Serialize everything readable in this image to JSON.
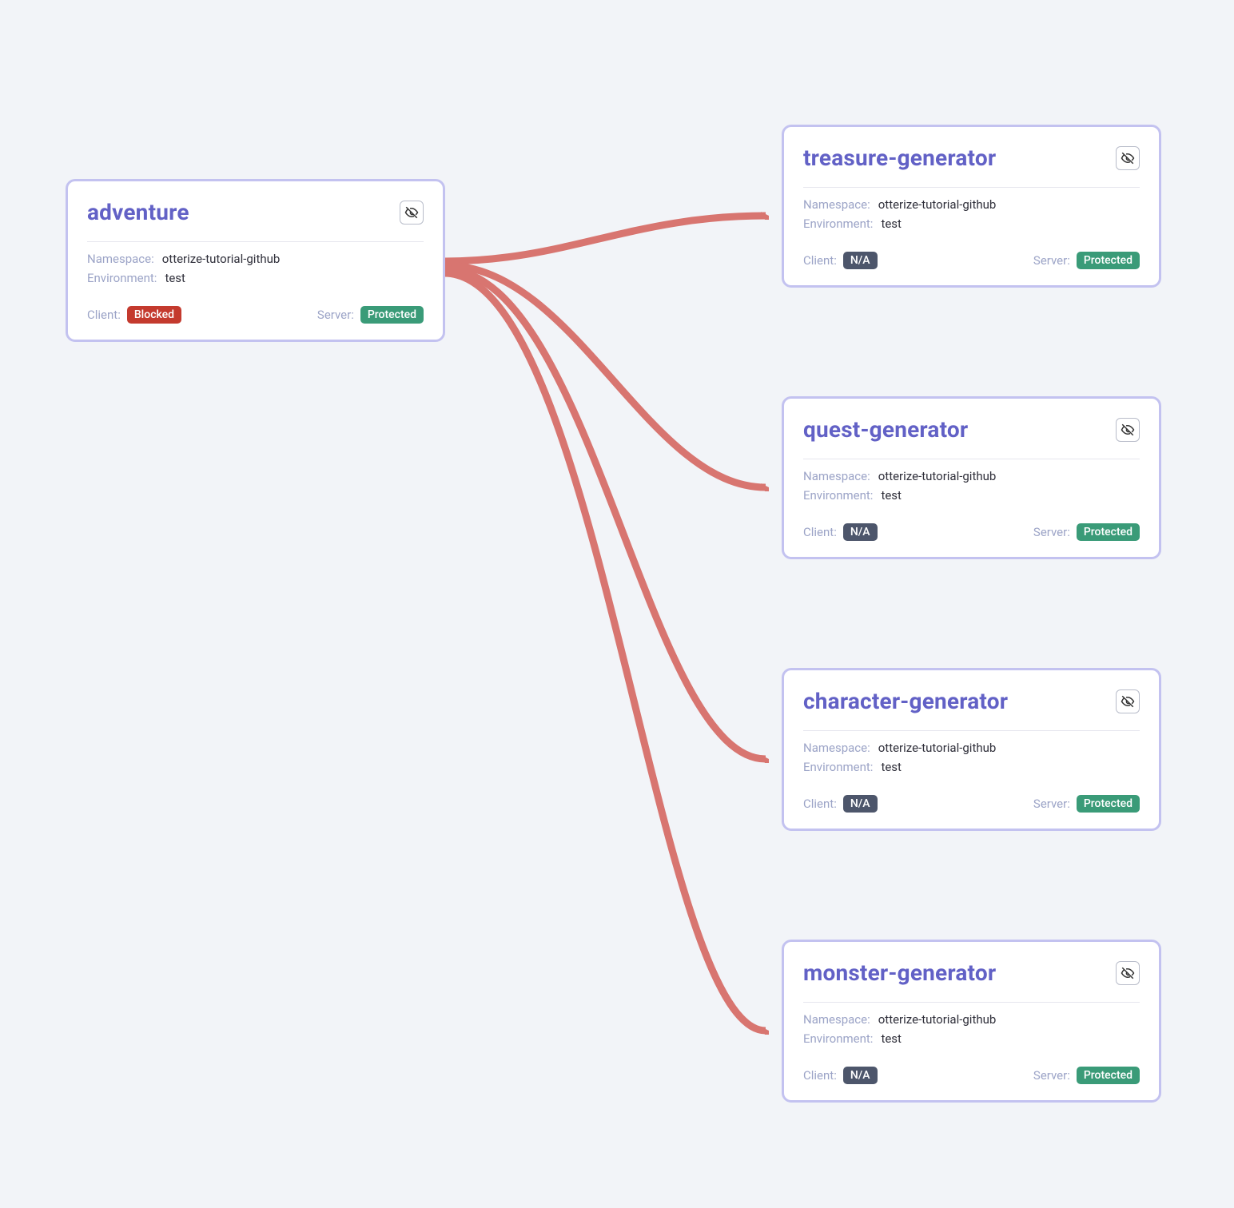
{
  "labels": {
    "namespace": "Namespace:",
    "environment": "Environment:",
    "client": "Client:",
    "server": "Server:"
  },
  "badges": {
    "blocked": "Blocked",
    "na": "N/A",
    "protected": "Protected"
  },
  "colors": {
    "node_border": "#c3c2f0",
    "node_title": "#6261c6",
    "arrow": "#d87570",
    "background": "#f2f4f8",
    "badge_blocked": "#c43a2e",
    "badge_na": "#4d566b",
    "badge_protected": "#3a9b78"
  },
  "icons": {
    "visibility_off": "visibility-off-icon"
  },
  "nodes": {
    "source": {
      "title": "adventure",
      "namespace": "otterize-tutorial-github",
      "environment": "test",
      "client_status": "Blocked",
      "server_status": "Protected"
    },
    "targets": [
      {
        "id": "treasure-generator",
        "title": "treasure-generator",
        "namespace": "otterize-tutorial-github",
        "environment": "test",
        "client_status": "N/A",
        "server_status": "Protected"
      },
      {
        "id": "quest-generator",
        "title": "quest-generator",
        "namespace": "otterize-tutorial-github",
        "environment": "test",
        "client_status": "N/A",
        "server_status": "Protected"
      },
      {
        "id": "character-generator",
        "title": "character-generator",
        "namespace": "otterize-tutorial-github",
        "environment": "test",
        "client_status": "N/A",
        "server_status": "Protected"
      },
      {
        "id": "monster-generator",
        "title": "monster-generator",
        "namespace": "otterize-tutorial-github",
        "environment": "test",
        "client_status": "N/A",
        "server_status": "Protected"
      }
    ]
  },
  "edges": [
    {
      "from": "adventure",
      "to": "treasure-generator"
    },
    {
      "from": "adventure",
      "to": "quest-generator"
    },
    {
      "from": "adventure",
      "to": "character-generator"
    },
    {
      "from": "adventure",
      "to": "monster-generator"
    }
  ]
}
